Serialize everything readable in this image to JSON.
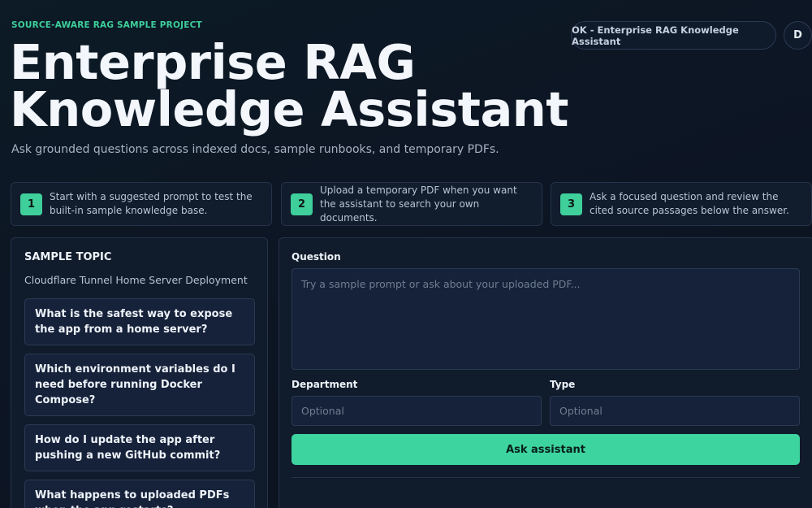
{
  "header": {
    "eyebrow": "SOURCE-AWARE RAG SAMPLE PROJECT",
    "title_line1": "Enterprise RAG",
    "title_line2": "Knowledge Assistant",
    "subtitle": "Ask grounded questions across indexed docs, sample runbooks, and temporary PDFs.",
    "status": "OK - Enterprise RAG Knowledge Assistant",
    "avatar_initial": "D"
  },
  "steps": [
    {
      "number": "1",
      "text": "Start with a suggested prompt to test the built-in sample knowledge base."
    },
    {
      "number": "2",
      "text": "Upload a temporary PDF when you want the assistant to search your own documents."
    },
    {
      "number": "3",
      "text": "Ask a focused question and review the cited source passages below the answer."
    }
  ],
  "sidebar": {
    "heading": "SAMPLE TOPIC",
    "topic": "Cloudflare Tunnel Home Server Deployment",
    "prompts": [
      "What is the safest way to expose the app from a home server?",
      "Which environment variables do I need before running Docker Compose?",
      "How do I update the app after pushing a new GitHub commit?",
      "What happens to uploaded PDFs when the app restarts?"
    ]
  },
  "form": {
    "question_label": "Question",
    "question_placeholder": "Try a sample prompt or ask about your uploaded PDF...",
    "department_label": "Department",
    "department_placeholder": "Optional",
    "type_label": "Type",
    "type_placeholder": "Optional",
    "submit_label": "Ask assistant"
  },
  "colors": {
    "accent": "#3dd4a0",
    "background": "#0d1624",
    "panel": "#101b2b"
  }
}
